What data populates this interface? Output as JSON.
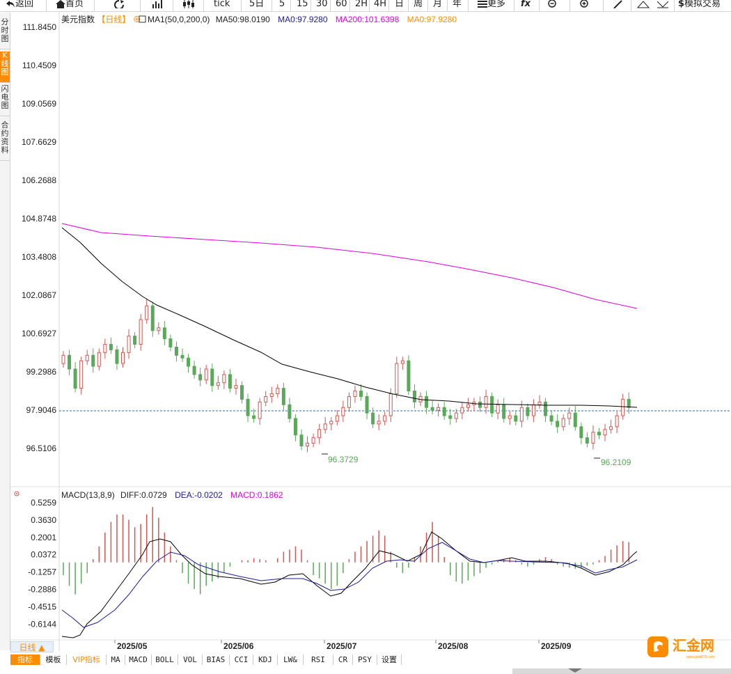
{
  "toolbar": {
    "back": "返回",
    "home": "首页",
    "tick": "tick",
    "five_day": "5日",
    "m5": "5",
    "m15": "15",
    "m30": "30",
    "m60": "60",
    "h2": "2H",
    "h4": "4H",
    "day": "日",
    "week": "周",
    "month": "月",
    "year": "年",
    "more": "更多",
    "fx": "fx",
    "sim_trade": "模拟交易"
  },
  "side_tabs": [
    "分时图",
    "K线图",
    "闪电图",
    "合约资料"
  ],
  "header": {
    "name": "美元指数",
    "period": "【日线】",
    "indicator": "MA1(50,0,200,0)",
    "ma50": "MA50:98.0190",
    "ma0": "MA0:97.9280",
    "ma200": "MA200:101.6398",
    "ma0b": "MA0:97.9280"
  },
  "macd_header": {
    "name": "MACD(13,8,9)",
    "diff": "DIFF:0.0729",
    "dea": "DEA:-0.0202",
    "macd": "MACD:0.1862"
  },
  "price_axis": [
    "111.8450",
    "110.4509",
    "109.0569",
    "107.6629",
    "106.2688",
    "104.8748",
    "103.4808",
    "102.0867",
    "100.6927",
    "99.2986",
    "97.9046",
    "96.5106"
  ],
  "macd_axis": [
    "0.5259",
    "0.3630",
    "0.2001",
    "0.0372",
    "-0.1257",
    "-0.2886",
    "-0.4515",
    "-0.6144"
  ],
  "annotations": {
    "low1": "96.3729",
    "low2": "96.2109",
    "ref_price": "97.9046"
  },
  "date_axis": [
    "2025/05",
    "2025/06",
    "2025/07",
    "2025/08",
    "2025/09"
  ],
  "period_button": "日线 ▲",
  "bottom_tabs": [
    "指标",
    "模板",
    "VIP指标",
    "MA",
    "MACD",
    "BOLL",
    "VOL",
    "BIAS",
    "CCI",
    "KDJ",
    "LW&",
    "RSI",
    "CR",
    "PSY",
    "设置"
  ],
  "logo": {
    "cn": "汇金网",
    "url": "www.gold678.com"
  },
  "colors": {
    "up": "#d9544f",
    "down": "#5aa85a",
    "ma50": "#000000",
    "ma200": "#e000e0",
    "dea": "#1a1aa0",
    "accent": "#ff8c00",
    "ref_line": "#2b6cb0"
  }
}
